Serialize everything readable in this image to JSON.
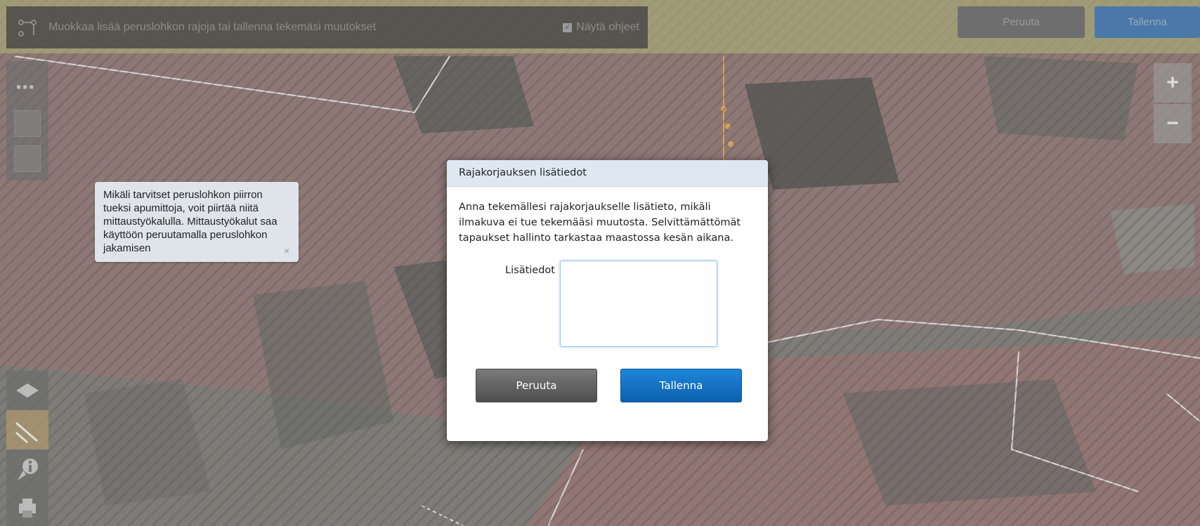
{
  "toolbar": {
    "instruction": "Muokkaa lisää peruslohkon rajoja tai tallenna tekemäsi muutokset",
    "show_help_label": "Näytä ohjeet",
    "show_help_checked": true,
    "cancel_label": "Peruuta",
    "save_label": "Tallenna"
  },
  "zoom": {
    "in_label": "+",
    "out_label": "−"
  },
  "tooltip": {
    "text": "Mikäli tarvitset peruslohkon piirron tueksi apumittoja, voit piirtää niitä mittaustyökalulla. Mittaustyökalut saa käyttöön peruutamalla peruslohkon jakamisen",
    "close_label": "×"
  },
  "dialog": {
    "title": "Rajakorjauksen lisätiedot",
    "description": "Anna tekemällesi rajakorjaukselle lisätieto, mikäli ilmakuva ei tue tekemääsi muutosta. Selvittämättömät tapaukset hallinto tarkastaa maastossa kesän aikana.",
    "field_label": "Lisätiedot",
    "field_value": "",
    "cancel_label": "Peruuta",
    "save_label": "Tallenna"
  },
  "colors": {
    "dialog_save": "#0d6ec4",
    "dialog_cancel": "#5e5e5e",
    "field_red_overlay": "#b06a6a",
    "tooltip_bg": "#dfe4ea"
  }
}
